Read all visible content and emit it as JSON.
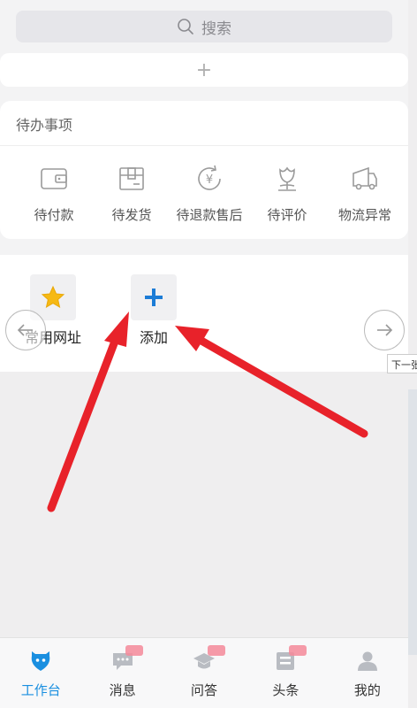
{
  "search": {
    "placeholder": "搜索"
  },
  "add_card": {
    "label": "+"
  },
  "todo": {
    "title": "待办事项",
    "items": [
      {
        "label": "待付款",
        "icon": "wallet-icon"
      },
      {
        "label": "待发货",
        "icon": "package-icon"
      },
      {
        "label": "待退款售后",
        "icon": "refund-icon"
      },
      {
        "label": "待评价",
        "icon": "flower-icon"
      },
      {
        "label": "物流异常",
        "icon": "truck-icon"
      }
    ]
  },
  "shortcuts": {
    "items": [
      {
        "label": "常用网址",
        "icon": "star-icon"
      },
      {
        "label": "添加",
        "icon": "plus-icon"
      }
    ]
  },
  "tooltip": {
    "text": "下一张"
  },
  "tabbar": {
    "active_color": "#1a8fe0",
    "tabs": [
      {
        "label": "工作台",
        "icon": "workbench-icon",
        "active": true
      },
      {
        "label": "消息",
        "icon": "message-icon"
      },
      {
        "label": "问答",
        "icon": "qa-icon"
      },
      {
        "label": "头条",
        "icon": "news-icon"
      },
      {
        "label": "我的",
        "icon": "profile-icon"
      }
    ]
  },
  "annotation_color": "#e8222a"
}
